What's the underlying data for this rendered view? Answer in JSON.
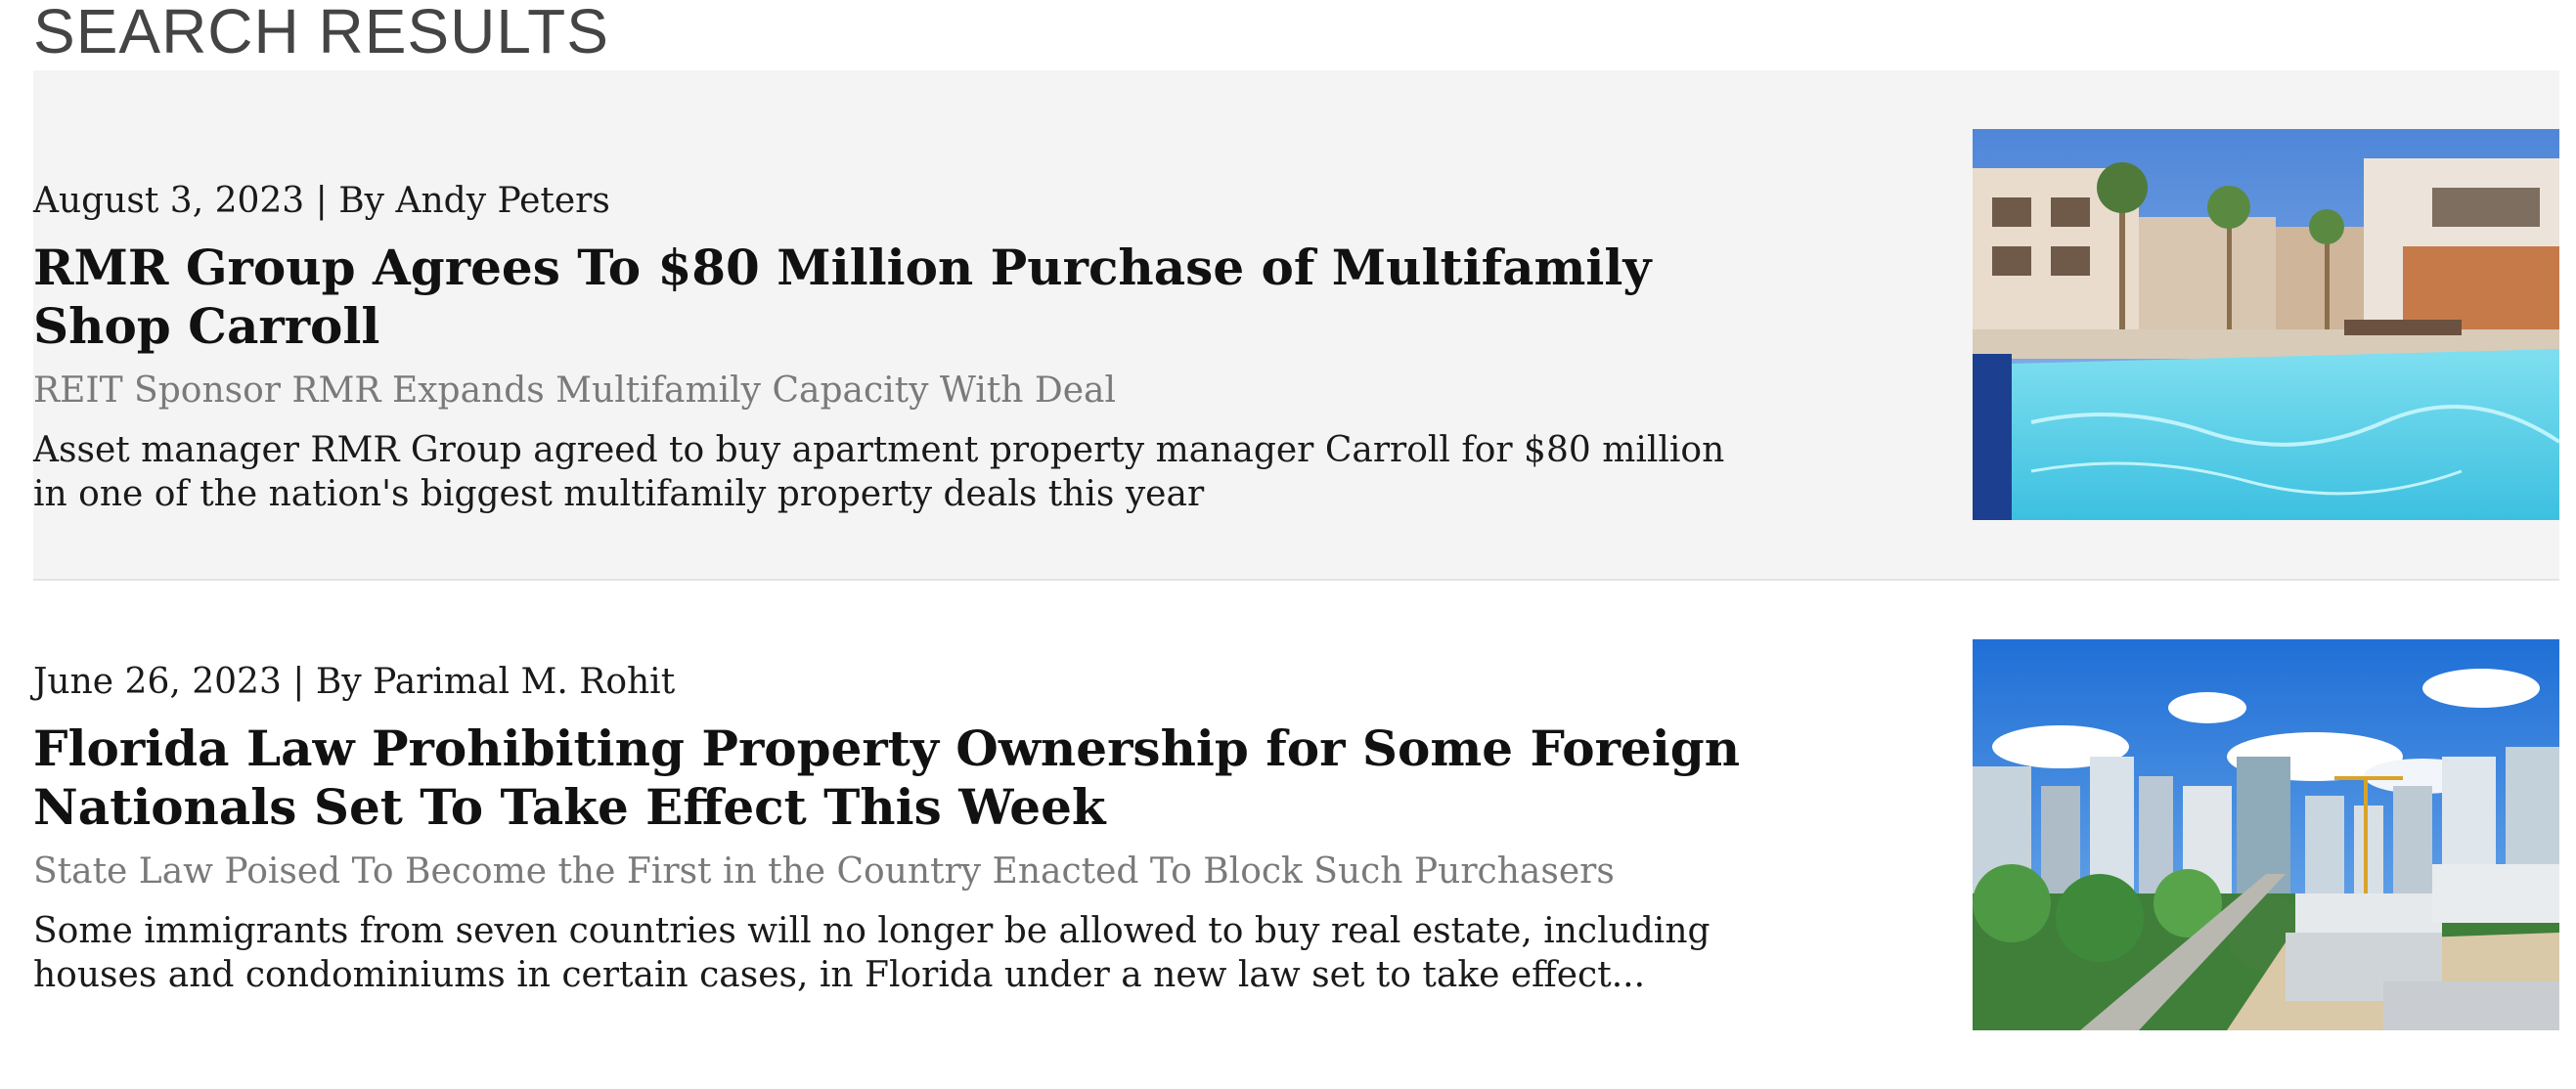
{
  "page": {
    "title": "SEARCH RESULTS"
  },
  "results": [
    {
      "meta": "August 3, 2023 | By Andy Peters",
      "headline": "RMR Group Agrees To $80 Million Purchase of Multifamily Shop Carroll",
      "subhead": "REIT Sponsor RMR Expands Multifamily Capacity With Deal",
      "summary": "Asset manager RMR Group agreed to buy apartment property manager Carroll for $80 million in one of the nation's biggest multifamily property deals this year",
      "image": "apartment-pool-photo"
    },
    {
      "meta": "June 26, 2023 | By Parimal M. Rohit",
      "headline": "Florida Law Prohibiting Property Ownership for Some Foreign Nationals Set To Take Effect This Week",
      "subhead": "State Law Poised To Become the First in the Country Enacted To Block Such Purchasers",
      "summary": "Some immigrants from seven countries will no longer be allowed to buy real estate, including houses and condominiums in certain cases, in Florida under a new law set to take effect...",
      "image": "city-skyline-photo"
    }
  ]
}
